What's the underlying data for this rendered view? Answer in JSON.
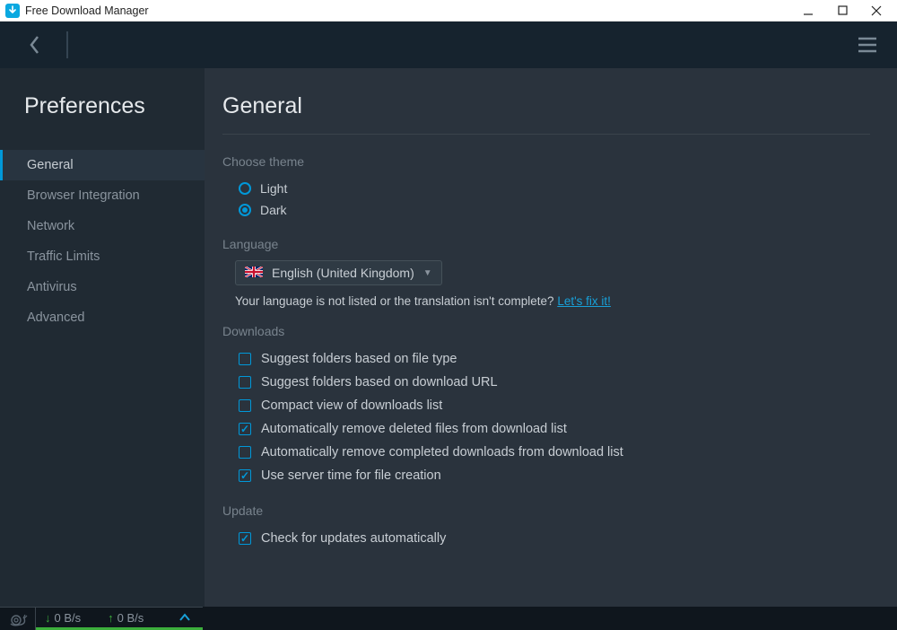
{
  "window": {
    "title": "Free Download Manager"
  },
  "sidebar": {
    "title": "Preferences",
    "items": [
      {
        "label": "General",
        "active": true
      },
      {
        "label": "Browser Integration",
        "active": false
      },
      {
        "label": "Network",
        "active": false
      },
      {
        "label": "Traffic Limits",
        "active": false
      },
      {
        "label": "Antivirus",
        "active": false
      },
      {
        "label": "Advanced",
        "active": false
      }
    ]
  },
  "main": {
    "heading": "General",
    "theme": {
      "label": "Choose theme",
      "options": [
        {
          "label": "Light",
          "checked": false
        },
        {
          "label": "Dark",
          "checked": true
        }
      ]
    },
    "language": {
      "label": "Language",
      "selected": "English (United Kingdom)",
      "hint_prefix": "Your language is not listed or the translation isn't complete? ",
      "hint_link": "Let's fix it!"
    },
    "downloads": {
      "label": "Downloads",
      "options": [
        {
          "label": "Suggest folders based on file type",
          "checked": false
        },
        {
          "label": "Suggest folders based on download URL",
          "checked": false
        },
        {
          "label": "Compact view of downloads list",
          "checked": false
        },
        {
          "label": "Automatically remove deleted files from download list",
          "checked": true
        },
        {
          "label": "Automatically remove completed downloads from download list",
          "checked": false
        },
        {
          "label": "Use server time for file creation",
          "checked": true
        }
      ]
    },
    "update": {
      "label": "Update",
      "options": [
        {
          "label": "Check for updates automatically",
          "checked": true
        }
      ]
    }
  },
  "status": {
    "down_speed": "0 B/s",
    "up_speed": "0 B/s"
  }
}
